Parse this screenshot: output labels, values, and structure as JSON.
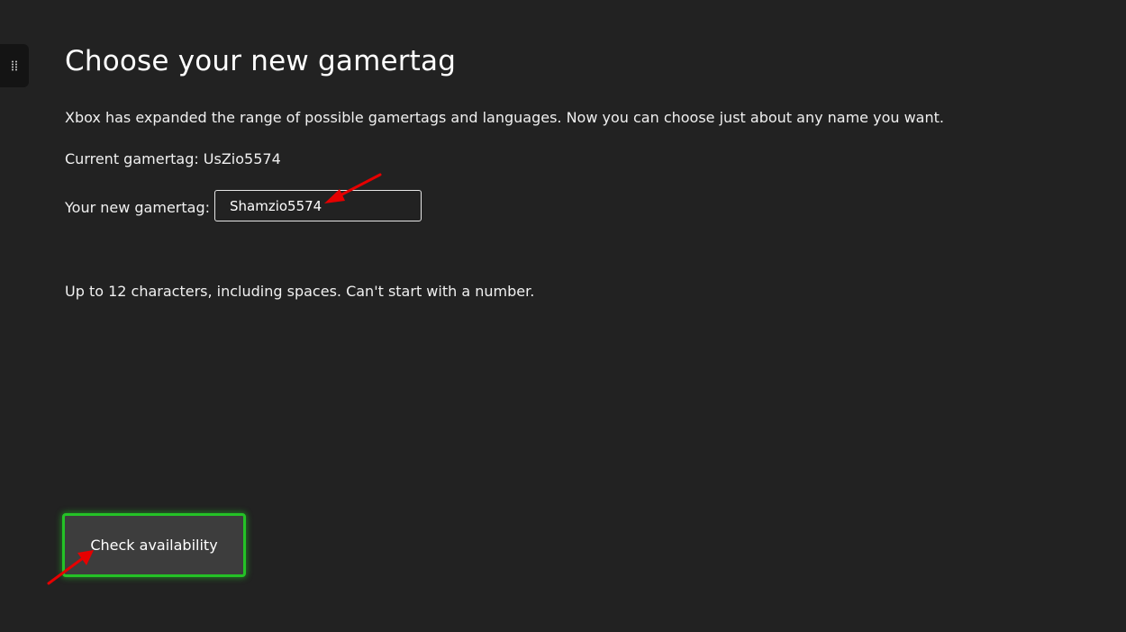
{
  "page": {
    "title": "Choose your new gamertag",
    "description": "Xbox has expanded the range of possible gamertags and languages. Now you can choose just about any name you want."
  },
  "current_gamertag": {
    "label": "Current gamertag:",
    "value": "UsZio5574"
  },
  "new_gamertag": {
    "label": "Your new gamertag:",
    "value": "Shamzio5574"
  },
  "hint": "Up to 12 characters, including spaces. Can't start with a number.",
  "actions": {
    "check_label": "Check availability"
  },
  "colors": {
    "background": "#222222",
    "focus_green": "#24c226",
    "annotation_red": "#e60000"
  },
  "icons": {
    "side_handle": "grip-dots-icon",
    "annotations": "red-arrow-icon"
  }
}
